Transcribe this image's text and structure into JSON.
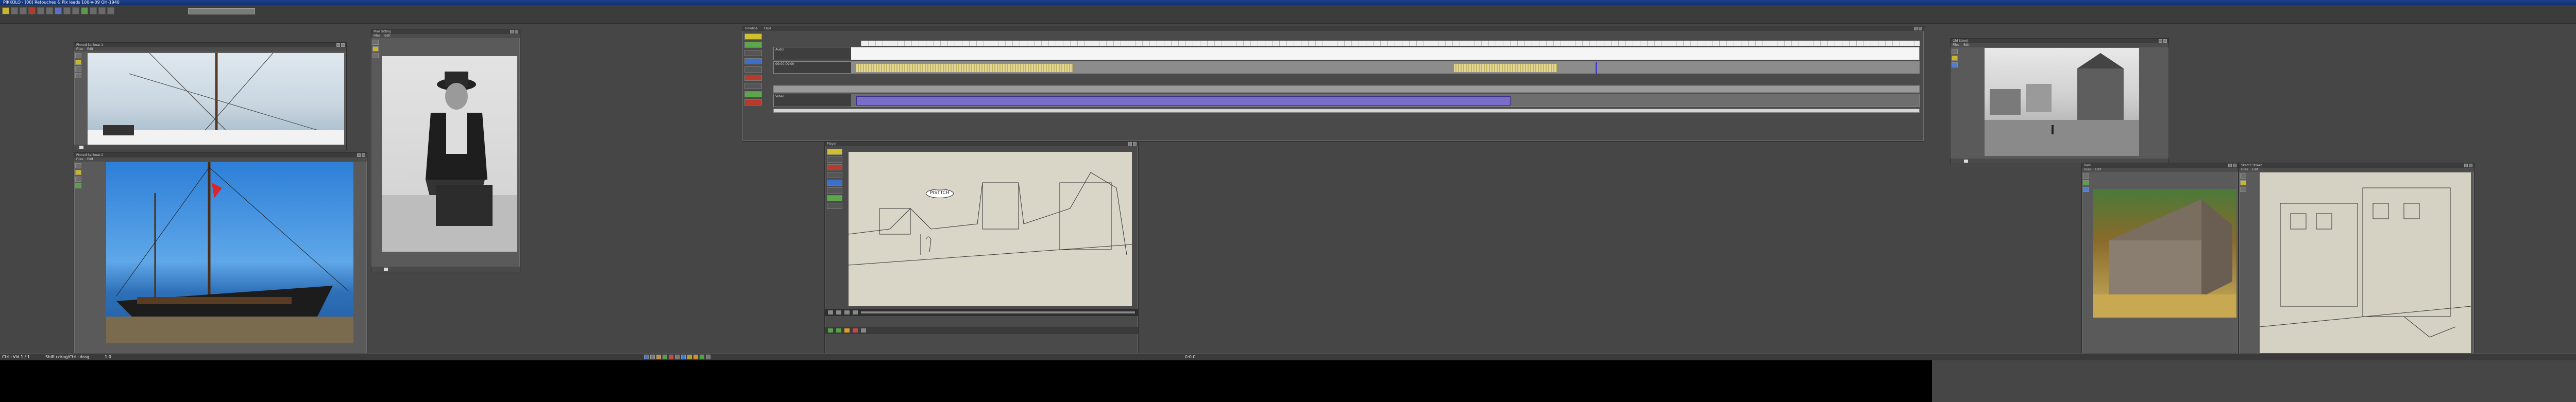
{
  "app": {
    "title": "PIKKOLO - [00] Retouches & Pix leads 100-V-09 OH-1940",
    "accent_color": "#1d3f8a"
  },
  "statusbar": {
    "left_text": "Ctrl+Vid 1 / 1",
    "mid_text": "Shift+drag/Ctrl+drag",
    "zoom_text": "1.0",
    "frame_text": "0:0.0"
  },
  "panels": {
    "sailboat_top": {
      "title": "Pinned Sailboat 1",
      "menu": [
        "Files",
        "Edit"
      ]
    },
    "sailboat_main": {
      "title": "Pinned Sailboat 2",
      "menu": [
        "Files",
        "Edit"
      ]
    },
    "man_photo": {
      "title": "Man Sitting",
      "menu": [
        "Files",
        "Edit"
      ]
    },
    "street_photo": {
      "title": "Old Street",
      "menu": [
        "Files",
        "Edit"
      ]
    },
    "barn_photo": {
      "title": "Barn",
      "menu": [
        "Files",
        "Edit"
      ]
    },
    "sketch_photo": {
      "title": "Sketch Street",
      "menu": [
        "Files",
        "Edit"
      ]
    },
    "player": {
      "title": "Player",
      "speech_bubble": "PISTTCH"
    }
  },
  "timeline": {
    "track1_label": "Audio",
    "track2_label": "00:00:00:00",
    "track3_label": "Video",
    "header_tabs": [
      "Timeline",
      "Clips"
    ]
  },
  "icons": [
    "new-icon",
    "open-icon",
    "save-icon",
    "undo-icon",
    "redo-icon",
    "cut-icon",
    "copy-icon",
    "paste-icon"
  ]
}
